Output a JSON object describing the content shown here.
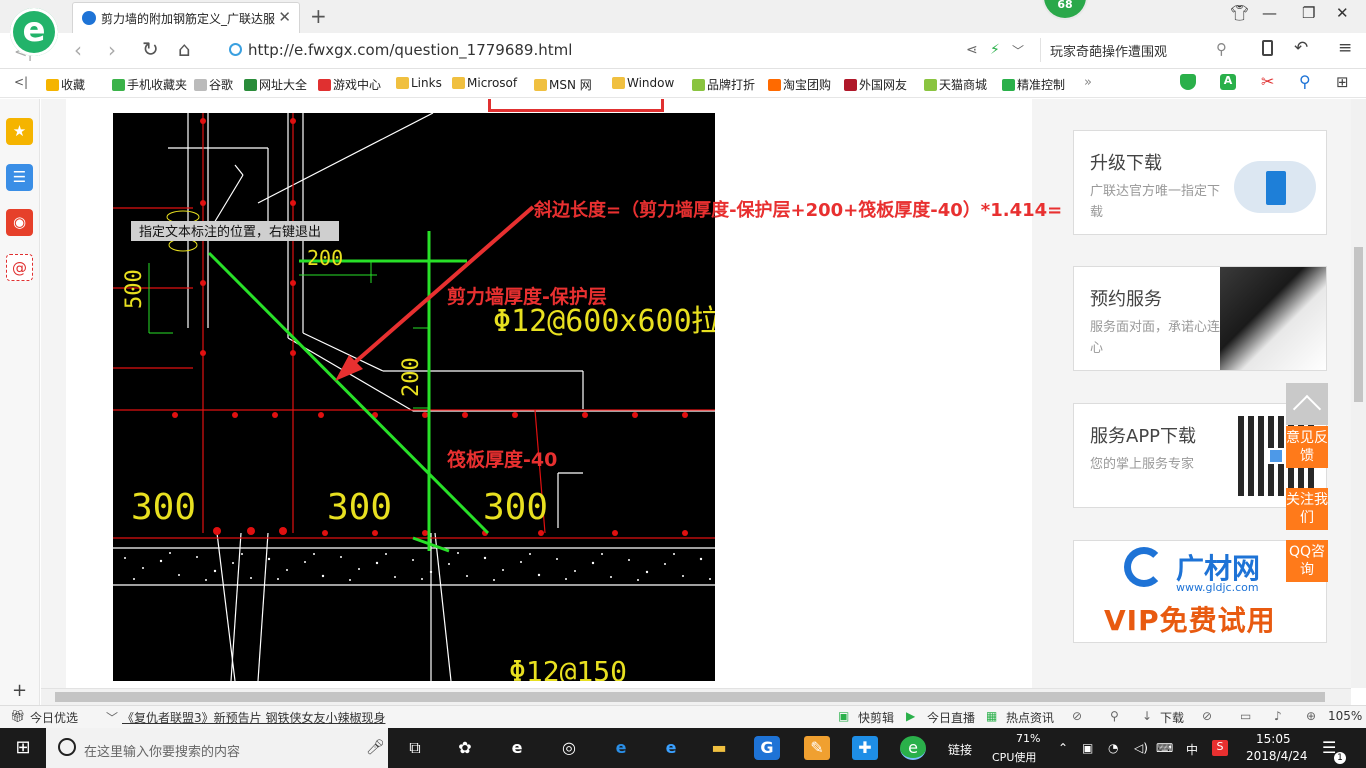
{
  "tab": {
    "title": "剪力墙的附加钢筋定义_广联达服",
    "close": "✕",
    "new_tab": "+"
  },
  "badge": {
    "count": "68"
  },
  "address": {
    "url": "http://e.fwxgx.com/question_1779689.html",
    "search_text": "玩家奇葩操作遭围观"
  },
  "bookmarks": [
    {
      "label": "收藏",
      "color": "#f5b400"
    },
    {
      "label": "手机收藏夹",
      "color": "#3bb34a"
    },
    {
      "label": "谷歌",
      "color": "#bbbbbb"
    },
    {
      "label": "网址大全",
      "color": "#2a8c3a"
    },
    {
      "label": "游戏中心",
      "color": "#e03030"
    },
    {
      "label": "Links",
      "color": "#f0c040"
    },
    {
      "label": "Microsof",
      "color": "#f0c040"
    },
    {
      "label": "MSN 网",
      "color": "#f0c040"
    },
    {
      "label": "Window",
      "color": "#f0c040"
    },
    {
      "label": "品牌打折",
      "color": "#8ac440"
    },
    {
      "label": "淘宝团购",
      "color": "#ff6a00"
    },
    {
      "label": "外国网友",
      "color": "#b0182a"
    },
    {
      "label": "天猫商城",
      "color": "#8ac440"
    },
    {
      "label": "精准控制",
      "color": "#2ab04a"
    }
  ],
  "cad": {
    "tooltip": "指定文本标注的位置，右键退出",
    "formula": "斜边长度=（剪力墙厚度-保护层+200+筏板厚度-40）*1.414=",
    "label_wall": "剪力墙厚度-保护层",
    "label_raft": "筏板厚度-40",
    "dim_200_top": "200",
    "dim_200_side": "200",
    "dim_500": "500",
    "dim_300_a": "300",
    "dim_300_b": "300",
    "dim_300_c": "300",
    "rebar_text": "Φ12@600x600",
    "rebar_text_suffix": "拉",
    "rebar_bottom": "Φ12@150"
  },
  "cards": [
    {
      "title": "升级下载",
      "desc": "广联达官方唯一指定下载"
    },
    {
      "title": "预约服务",
      "desc": "服务面对面，承诺心连心"
    },
    {
      "title": "服务APP下载",
      "desc": "您的掌上服务专家"
    }
  ],
  "ad": {
    "brand": "广材网",
    "url": "www.gldjc.com",
    "slogan": "VIP免费试用"
  },
  "side_buttons": [
    "意见反馈",
    "关注我们",
    "QQ咨询"
  ],
  "statusbar": {
    "today": "今日优选",
    "news": "《复仇者联盟3》新预告片 钢铁侠女友小辣椒现身",
    "quick_cut": "快剪辑",
    "live": "今日直播",
    "hot_news": "热点资讯",
    "download": "下载",
    "zoom": "105%"
  },
  "taskbar": {
    "search_placeholder": "在这里输入你要搜索的内容",
    "link": "链接",
    "cpu_percent": "71%",
    "cpu_label": "CPU使用",
    "ime": "中",
    "time": "15:05",
    "date": "2018/4/24",
    "notif_count": "1"
  }
}
